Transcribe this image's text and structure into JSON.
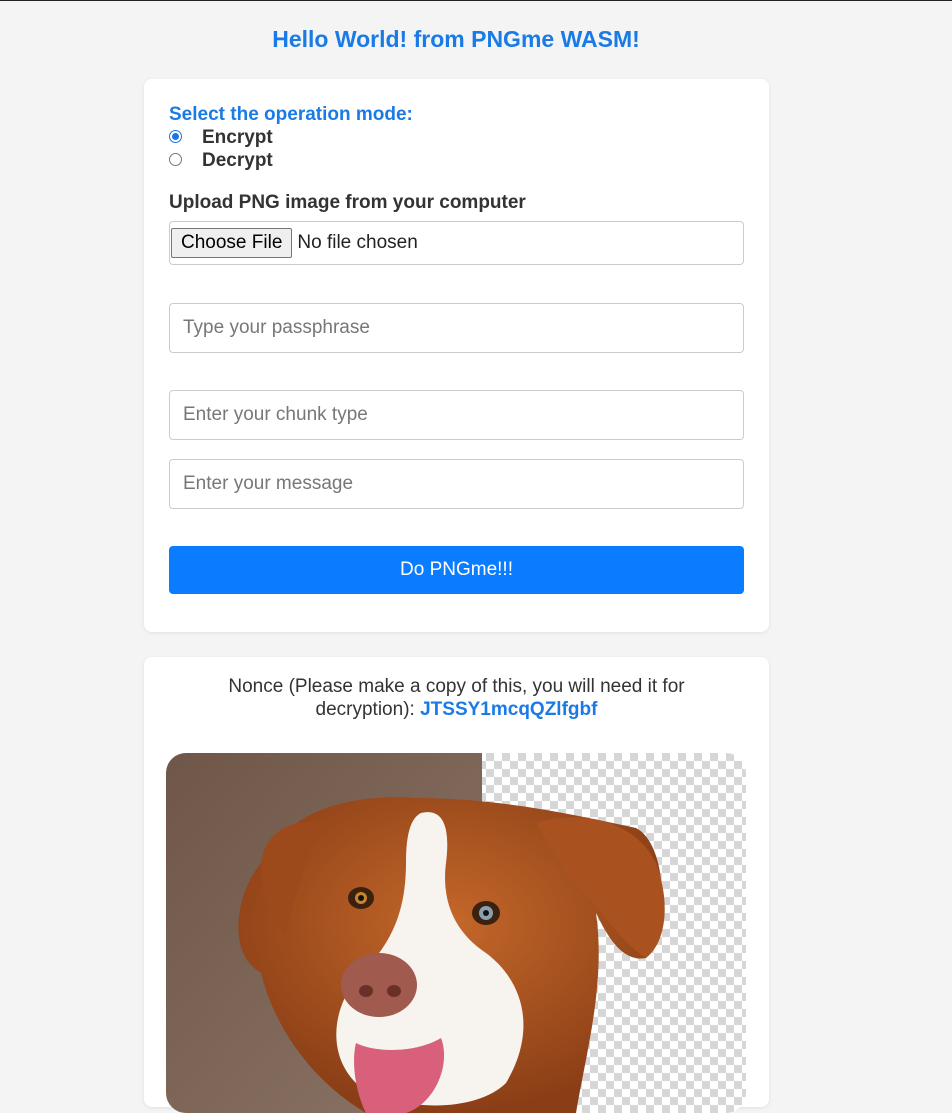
{
  "header": {
    "title": "Hello World! from PNGme WASM!"
  },
  "form": {
    "mode_label": "Select the operation mode:",
    "modes": [
      {
        "label": "Encrypt",
        "checked": true
      },
      {
        "label": "Decrypt",
        "checked": false
      }
    ],
    "upload_label": "Upload PNG image from your computer",
    "choose_file_label": "Choose File",
    "file_status": "No file chosen",
    "passphrase_placeholder": "Type your passphrase",
    "chunk_type_placeholder": "Enter your chunk type",
    "message_placeholder": "Enter your message",
    "submit_label": "Do PNGme!!!"
  },
  "result": {
    "nonce_text": "Nonce (Please make a copy of this, you will need it for decryption):",
    "nonce_value": "JTSSY1mcqQZlfgbf",
    "image_subject": "dog-photo-with-transparent-background"
  },
  "colors": {
    "accent": "#1a7be6",
    "button": "#0a7cff",
    "page_bg": "#f4f4f4"
  }
}
